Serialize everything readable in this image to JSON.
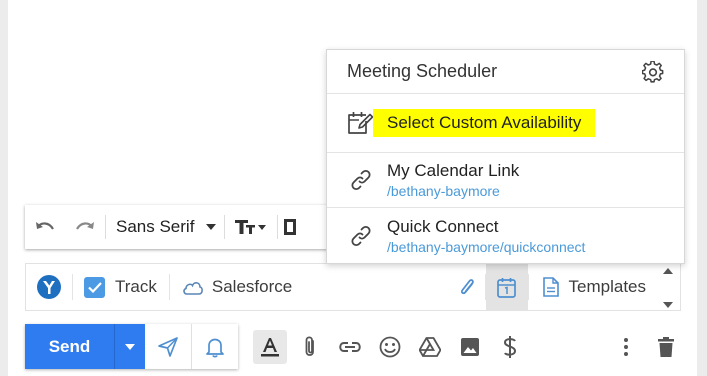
{
  "format_toolbar": {
    "font_name": "Sans Serif"
  },
  "plugin_bar": {
    "track_label": "Track",
    "salesforce_label": "Salesforce",
    "templates_label": "Templates"
  },
  "send_bar": {
    "send_label": "Send"
  },
  "scheduler": {
    "title": "Meeting Scheduler",
    "custom_availability_label": "Select Custom Availability",
    "calendar_link_title": "My Calendar Link",
    "calendar_link_url": "/bethany-baymore",
    "quick_connect_title": "Quick Connect",
    "quick_connect_url": "/bethany-baymore/quickconnect"
  },
  "colors": {
    "send_blue": "#2f7bf0",
    "checkbox_blue": "#4b9ae3",
    "link_blue": "#4a9ad8",
    "highlight_yellow": "#ffff00"
  }
}
